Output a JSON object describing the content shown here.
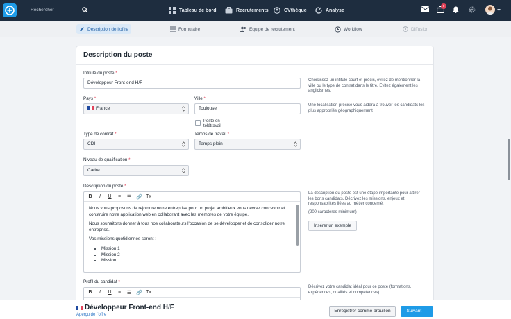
{
  "topbar": {
    "search_placeholder": "Rechercher",
    "nav": [
      {
        "label": "Tableau de bord",
        "icon": "dashboard-icon"
      },
      {
        "label": "Recrutements",
        "icon": "briefcase-icon"
      },
      {
        "label": "CVthèque",
        "icon": "cv-icon"
      },
      {
        "label": "Analyse",
        "icon": "analytics-icon"
      }
    ],
    "badge_count": "6"
  },
  "steps": [
    {
      "label": "Description de l'offre",
      "state": "active"
    },
    {
      "label": "Formulaire",
      "state": "normal"
    },
    {
      "label": "Equipe de recrutement",
      "state": "normal"
    },
    {
      "label": "Workflow",
      "state": "normal"
    },
    {
      "label": "Diffusion",
      "state": "disabled"
    }
  ],
  "card": {
    "title": "Description du poste",
    "job_title": {
      "label": "Intitulé du poste",
      "value": "Développeur Front-end H/F",
      "help": "Choisissez un intitulé court et précis, évitez de mentionner la ville ou le type de contrat dans le titre. Evitez également les anglicismes."
    },
    "country": {
      "label": "Pays",
      "value": "France"
    },
    "city": {
      "label": "Ville",
      "value": "Toulouse",
      "help": "Une localisation précise vous aidera à trouver les candidats les plus appropriés géographiquement"
    },
    "remote": {
      "label_line1": "Poste en",
      "label_line2": "télétravail"
    },
    "contract": {
      "label": "Type de contrat",
      "value": "CDI"
    },
    "work_time": {
      "label": "Temps de travail",
      "value": "Temps plein"
    },
    "qualification": {
      "label": "Niveau de qualification",
      "value": "Cadre"
    },
    "description": {
      "label": "Description du poste",
      "toolbar": [
        "B",
        "I",
        "U",
        "≡",
        "☰",
        "🔗",
        "Tx"
      ],
      "paragraph1": "Nous vous proposons de rejoindre notre entreprise pour un projet ambitieux vous devrez concevoir et construire notre application web en collaborant avec les membres de votre équipe.",
      "paragraph2": "Nous souhaitons donner à tous nos collaborateurs l'occasion de se développer et de consolider notre entreprise.",
      "paragraph3": "Vos missions quotidiennes seront :",
      "missions": [
        "Mission 1",
        "Mission 2",
        "Mission..."
      ],
      "help": "La description du poste est une étape importante pour attirer les bons candidats. Décrivez les missions, enjeux et responsabilités liées au métier concerné.",
      "help2": "(200 caractères minimum)",
      "example_button": "Insérer un exemple"
    },
    "candidate_profile": {
      "label": "Profil du candidat",
      "help": "Décrivez votre candidat idéal pour ce poste (formations, expériences, qualités et compétences)."
    }
  },
  "bottombar": {
    "title": "Développeur Front-end H/F",
    "preview_link": "Aperçu de l'offre",
    "draft_button": "Enregistrer comme brouillon",
    "next_button": "Suivant →"
  }
}
